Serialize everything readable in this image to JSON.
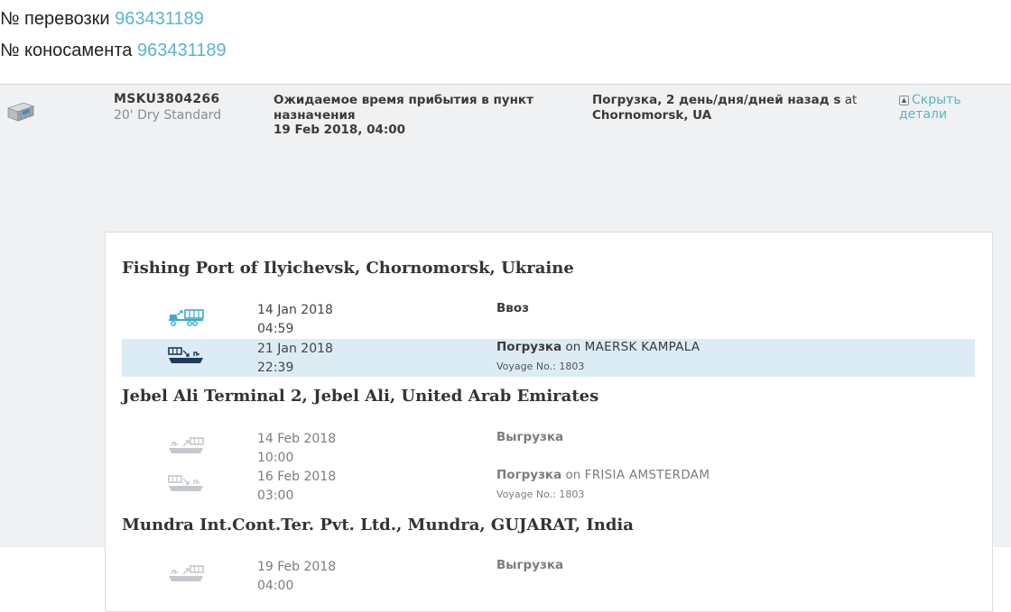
{
  "header": {
    "shipment_label": "№ перевозки",
    "shipment_number": "963431189",
    "bol_label": "№ коносамента",
    "bol_number": "963431189"
  },
  "container": {
    "id": "MSKU3804266",
    "type": "20' Dry Standard",
    "eta_label": "Ожидаемое время прибытия в пункт назначения",
    "eta_time": "19 Feb 2018, 04:00",
    "status_prefix": "Погрузка, 2 день/дня/дней назад s",
    "status_at": "at",
    "status_location": "Chornomorsk, UA",
    "hide_details": "Скрыть детали"
  },
  "locations": [
    {
      "name": "Fishing Port of Ilyichevsk, Chornomorsk, Ukraine",
      "events": [
        {
          "date": "14 Jan 2018",
          "time": "04:59",
          "action": "Ввоз",
          "on": "",
          "vessel": "",
          "voyage": "",
          "icon": "truck-container-icon"
        },
        {
          "date": "21 Jan 2018",
          "time": "22:39",
          "action": "Погрузка",
          "on": "on",
          "vessel": "MAERSK KAMPALA",
          "voyage": "Voyage No.: 1803",
          "icon": "vessel-load-icon"
        }
      ]
    },
    {
      "name": "Jebel Ali Terminal 2, Jebel Ali, United Arab Emirates",
      "events": [
        {
          "date": "14 Feb 2018",
          "time": "10:00",
          "action": "Выгрузка",
          "on": "",
          "vessel": "",
          "voyage": "",
          "icon": "vessel-discharge-icon"
        },
        {
          "date": "16 Feb 2018",
          "time": "03:00",
          "action": "Погрузка",
          "on": "on",
          "vessel": "FRISIA AMSTERDAM",
          "voyage": "Voyage No.: 1803",
          "icon": "vessel-load-icon"
        }
      ]
    },
    {
      "name": "Mundra Int.Cont.Ter. Pvt. Ltd., Mundra, GUJARAT, India",
      "events": [
        {
          "date": "19 Feb 2018",
          "time": "04:00",
          "action": "Выгрузка",
          "on": "",
          "vessel": "",
          "voyage": "",
          "icon": "vessel-discharge-icon"
        }
      ]
    }
  ],
  "colors": {
    "link": "#5ab4cc",
    "highlight_row": "#dcecf5",
    "active_icon": "#3fa9c9",
    "current_icon": "#1f3a5a",
    "future_icon": "#c4c8cc"
  }
}
